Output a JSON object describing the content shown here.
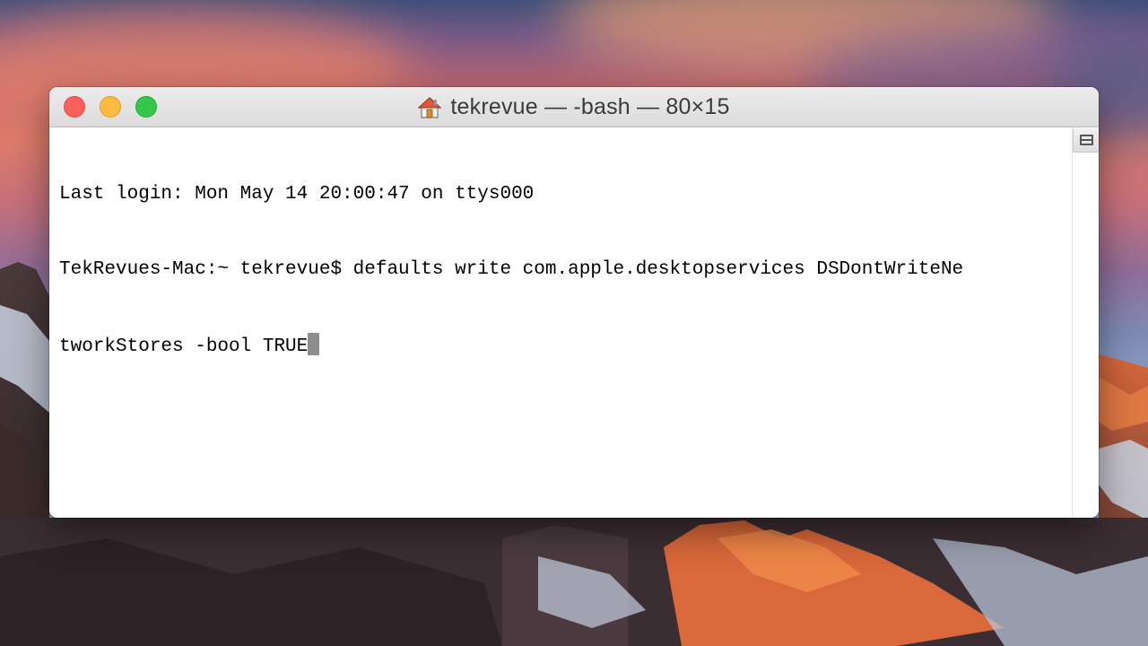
{
  "window": {
    "title": "tekrevue — -bash — 80×15",
    "title_icon": "home-icon"
  },
  "terminal": {
    "lines": [
      "Last login: Mon May 14 20:00:47 on ttys000",
      "TekRevues-Mac:~ tekrevue$ defaults write com.apple.desktopservices DSDontWriteNe",
      "tworkStores -bool TRUE"
    ],
    "cursor_style": "block"
  },
  "colors": {
    "close": "#fc605c",
    "minimize": "#fdbc40",
    "zoom": "#34c84a",
    "terminal_background": "#ffffff",
    "terminal_text": "#000000",
    "cursor": "#8e8e8e"
  },
  "icons": {
    "split_pane": "split-pane-icon"
  }
}
